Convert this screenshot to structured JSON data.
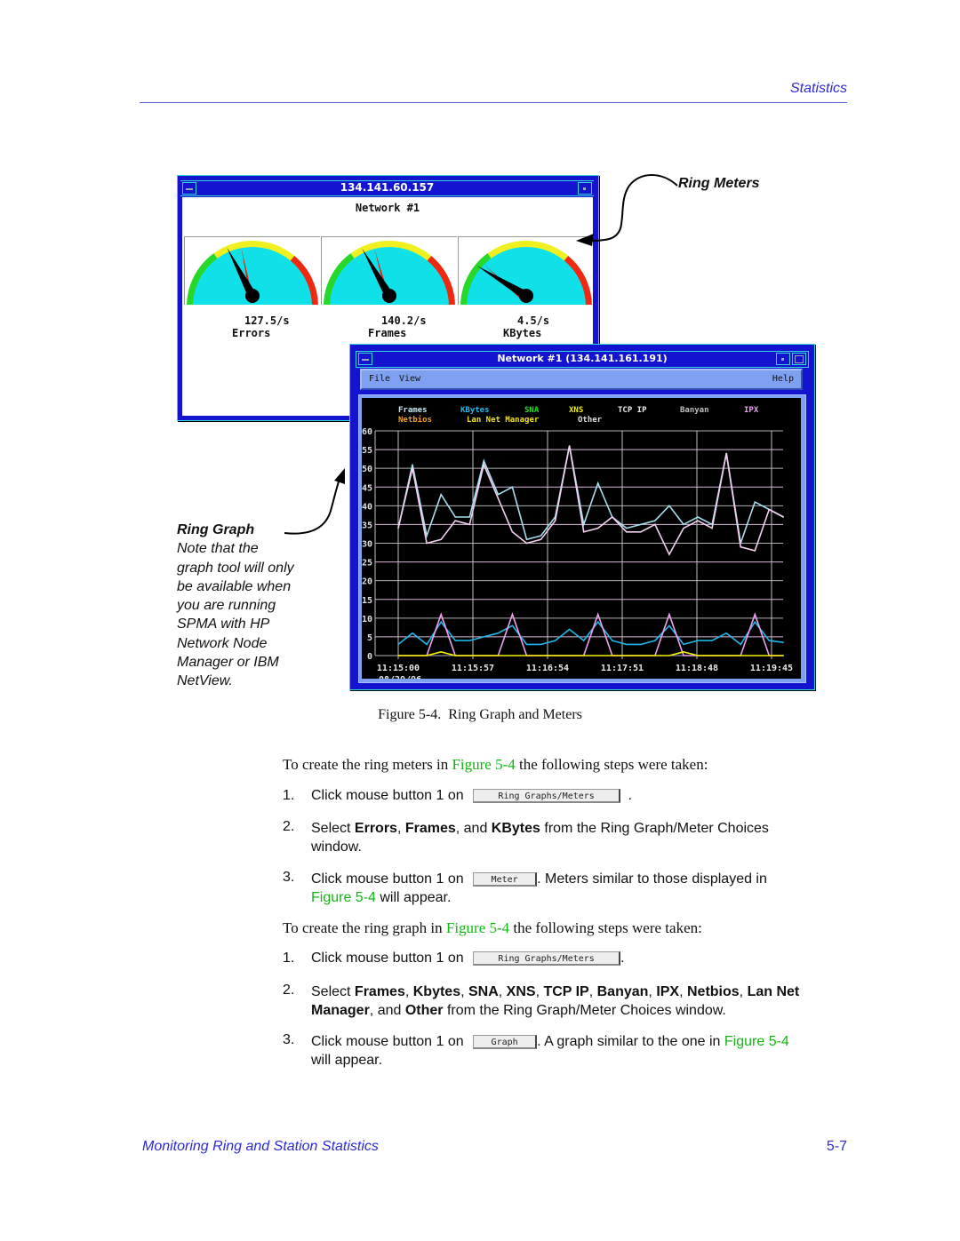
{
  "header": {
    "section": "Statistics"
  },
  "footer": {
    "chapter": "Monitoring Ring and Station Statistics",
    "page": "5-7"
  },
  "meter_window": {
    "title": "134.141.60.157",
    "network": "Network #1",
    "meters": [
      {
        "label": "Errors",
        "value": "127.5/s",
        "needle_fraction": 0.37,
        "peak_fraction": 0.44
      },
      {
        "label": "Frames",
        "value": "140.2/s",
        "needle_fraction": 0.36,
        "peak_fraction": 0.42
      },
      {
        "label": "KBytes",
        "value": "4.5/s",
        "needle_fraction": 0.22,
        "peak_fraction": 0.25
      }
    ]
  },
  "graph_window": {
    "title": "Network #1 (134.141.161.191)",
    "menu": {
      "file": "File",
      "view": "View",
      "help": "Help"
    }
  },
  "annotations": {
    "ring_meters": "Ring Meters",
    "ring_graph_title": "Ring Graph",
    "ring_graph_note": [
      "Note that the",
      "graph tool will only",
      "be available when",
      "you are running",
      "SPMA with HP",
      "Network Node",
      "Manager or IBM",
      "NetView."
    ]
  },
  "caption": {
    "label": "Figure 5-4.",
    "text": "Ring Graph and Meters"
  },
  "meters_intro": {
    "before": "To create the ring meters in ",
    "link": "Figure 5-4",
    "after": " the following steps were taken:"
  },
  "meters_steps": [
    {
      "num": "1.",
      "before": "Click mouse button 1 on",
      "button": "Ring Graphs/Meters",
      "after": "."
    },
    {
      "num": "2.",
      "parts": [
        "Select ",
        "Errors",
        ", ",
        "Frames",
        ", and ",
        "KBytes",
        " from the Ring Graph/Meter Choices"
      ],
      "line2": "window."
    },
    {
      "num": "3.",
      "before": "Click mouse button 1 on",
      "button": "Meter",
      "after": ". Meters similar to those displayed in",
      "link": "Figure 5-4",
      "after2": " will appear."
    }
  ],
  "graph_intro": {
    "before": "To create the ring graph in ",
    "link": "Figure 5-4",
    "after": " the following steps were taken:"
  },
  "graph_steps": [
    {
      "num": "1.",
      "before": "Click mouse button 1 on",
      "button": "Ring Graphs/Meters",
      "after": "."
    },
    {
      "num": "2.",
      "line1": [
        "Select ",
        "Frames",
        ", ",
        "Kbytes",
        ", ",
        "SNA",
        ", ",
        "XNS",
        ", ",
        "TCP IP",
        ", ",
        "Banyan",
        ", ",
        "IPX",
        ", ",
        "Netbios",
        ", ",
        "Lan Net"
      ],
      "line2": [
        "Manager",
        ", and ",
        "Other",
        " from the Ring Graph/Meter Choices window."
      ]
    },
    {
      "num": "3.",
      "before": "Click mouse button 1 on",
      "button": "Graph",
      "after": ". A graph similar to the one in ",
      "link": "Figure 5-4",
      "line2": "will appear."
    }
  ],
  "chart_data": {
    "type": "line",
    "title": "Network #1 (134.141.161.191)",
    "xlabel": "",
    "ylabel": "",
    "ylim": [
      0,
      60
    ],
    "yticks": [
      0,
      5,
      10,
      15,
      20,
      25,
      30,
      35,
      40,
      45,
      50,
      55,
      60
    ],
    "x_tick_labels": [
      "11:15:00",
      "11:15:57",
      "11:16:54",
      "11:17:51",
      "11:18:48",
      "11:19:45"
    ],
    "x_date": "08/29/96",
    "grid": true,
    "legend": [
      {
        "name": "Frames",
        "color": "#c8e8f0"
      },
      {
        "name": "KBytes",
        "color": "#20b8e8"
      },
      {
        "name": "SNA",
        "color": "#20e020"
      },
      {
        "name": "XNS",
        "color": "#f0f000"
      },
      {
        "name": "TCP IP",
        "color": "#e8e8e8"
      },
      {
        "name": "Banyan",
        "color": "#c0c0c0"
      },
      {
        "name": "IPX",
        "color": "#f0a0f0"
      },
      {
        "name": "Netbios",
        "color": "#f0a020"
      },
      {
        "name": "Lan Net Manager",
        "color": "#f0e020"
      },
      {
        "name": "Other",
        "color": "#e0e0e0"
      }
    ],
    "legend_position": "top",
    "series": [
      {
        "name": "Frames",
        "color": "#a8e0f0",
        "values": [
          34,
          51,
          32,
          43,
          37,
          37,
          52,
          43,
          45,
          31,
          32,
          37,
          56,
          35,
          46,
          37,
          34,
          35,
          36,
          40,
          35,
          37,
          35,
          54,
          30,
          41,
          39,
          37
        ]
      },
      {
        "name": "Other",
        "color": "#f4d0f0",
        "values": [
          34,
          50,
          30,
          31,
          36,
          35,
          51,
          42,
          33,
          30,
          31,
          36,
          56,
          33,
          34,
          37,
          33,
          33,
          35,
          27,
          34,
          36,
          34,
          54,
          29,
          28,
          39,
          37
        ]
      },
      {
        "name": "KBytes",
        "color": "#20b8e8",
        "values": [
          3,
          6,
          3,
          9,
          4,
          4,
          5,
          6,
          8,
          3,
          3,
          4,
          7,
          4,
          9,
          4,
          3,
          3,
          4,
          8,
          3,
          4,
          4,
          6,
          3,
          9,
          4,
          3.5
        ]
      },
      {
        "name": "IPX",
        "color": "#f0a0f0",
        "values": [
          0,
          0,
          0,
          11,
          0,
          0,
          0,
          0,
          11,
          0,
          0,
          0,
          0,
          0,
          11,
          0,
          0,
          0,
          0,
          11,
          0,
          0,
          0,
          0,
          0,
          11,
          0,
          0
        ]
      },
      {
        "name": "XNS",
        "color": "#f0f000",
        "values": [
          0,
          0,
          0,
          1,
          0,
          0,
          0,
          0,
          0,
          0,
          0,
          0,
          0,
          0,
          0,
          0,
          0,
          0,
          0,
          0,
          1,
          0,
          0,
          0,
          0,
          0,
          0,
          0
        ]
      }
    ]
  }
}
